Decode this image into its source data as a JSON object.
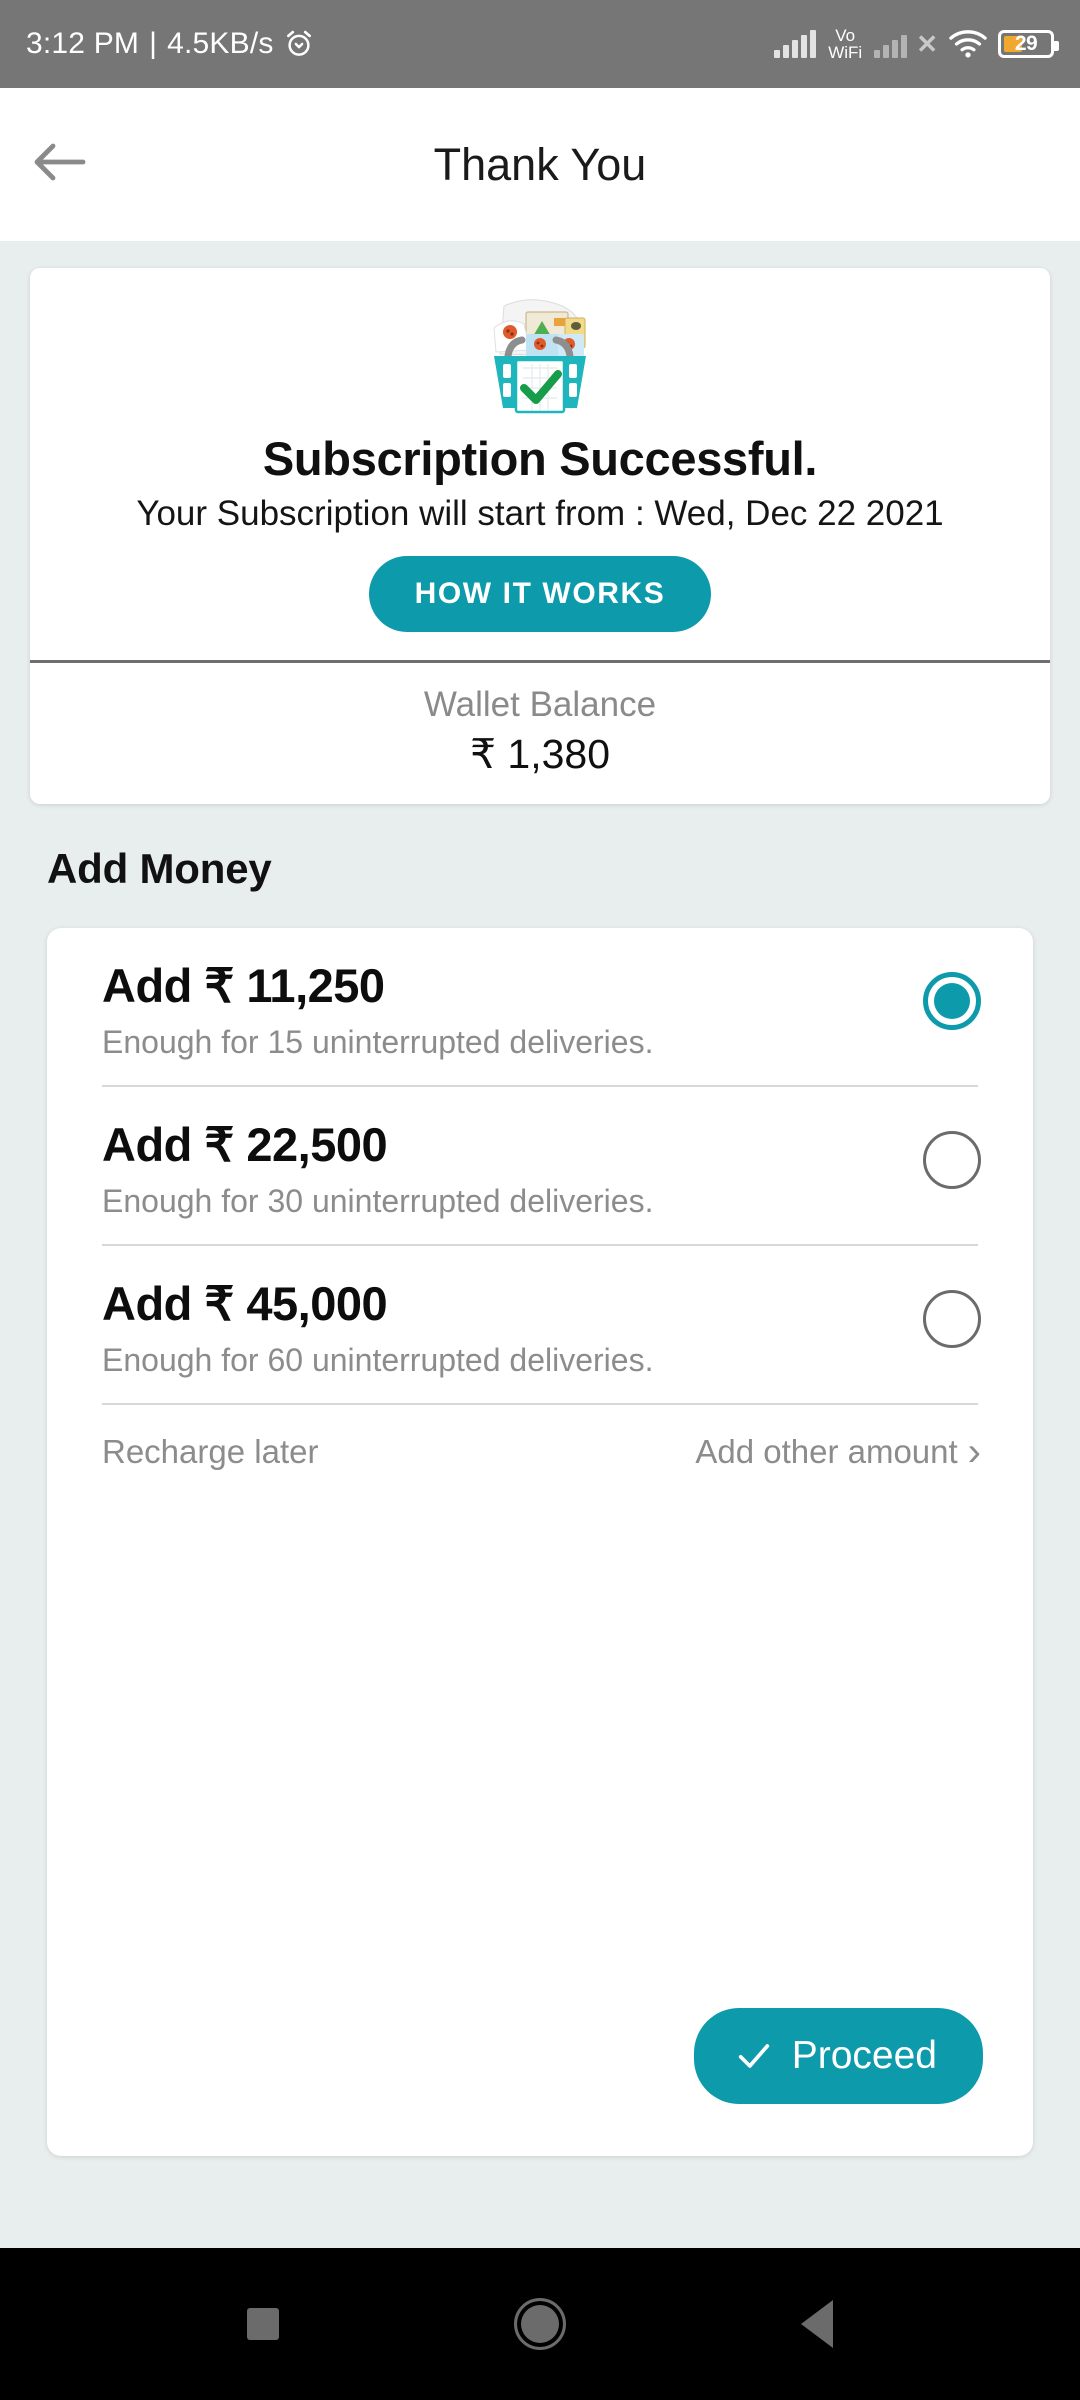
{
  "status_bar": {
    "time": "3:12 PM",
    "separator": "|",
    "network_speed": "4.5KB/s",
    "alarm_icon": "alarm-clock-icon",
    "volte_line1": "Vo",
    "volte_line2": "WiFi",
    "sim2_x": "✕",
    "wifi_icon": "wifi-icon",
    "battery_percent": "29",
    "background_color": "#767676"
  },
  "app_bar": {
    "back_icon": "back-arrow-icon",
    "title": "Thank You"
  },
  "success_card": {
    "illustration": "shopping-basket-with-checkmark",
    "title": "Subscription Successful.",
    "subtitle": "Your Subscription will start from : Wed, Dec 22 2021",
    "how_it_works_label": "HOW IT WORKS",
    "wallet_label": "Wallet Balance",
    "wallet_amount": "₹ 1,380"
  },
  "add_money": {
    "section_title": "Add Money",
    "options": [
      {
        "amount": "Add ₹ 11,250",
        "description": "Enough for 15 uninterrupted deliveries.",
        "selected": true
      },
      {
        "amount": "Add ₹ 22,500",
        "description": "Enough for 30 uninterrupted deliveries.",
        "selected": false
      },
      {
        "amount": "Add ₹ 45,000",
        "description": "Enough for 60 uninterrupted deliveries.",
        "selected": false
      }
    ],
    "recharge_later_label": "Recharge later",
    "other_amount_label": "Add other amount",
    "other_amount_chevron": "›",
    "proceed_label": "Proceed"
  },
  "nav_bar": {
    "recents_icon": "square-recents-icon",
    "home_icon": "circle-home-icon",
    "back_icon": "triangle-back-icon"
  },
  "colors": {
    "accent_teal": "#0d9aab",
    "page_background": "#e8eded",
    "status_bar_gray": "#767676",
    "battery_orange": "#f0a830",
    "muted_text": "#8c8c8c"
  }
}
